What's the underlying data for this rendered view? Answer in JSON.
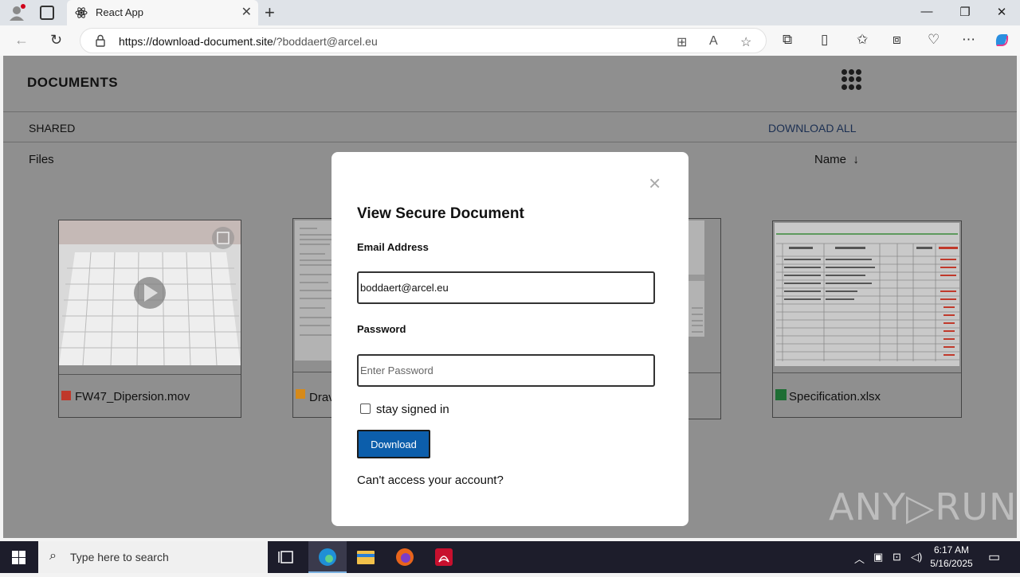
{
  "browser": {
    "tab_title": "React App",
    "url_host": "https://download-document.site",
    "url_path": "/?boddaert@arcel.eu",
    "minimize": "—",
    "restore": "❐",
    "close": "✕",
    "new_tab": "+"
  },
  "page": {
    "title": "DOCUMENTS",
    "shared_label": "SHARED",
    "download_all": "DOWNLOAD ALL",
    "files_label": "Files",
    "sort_label": "Name",
    "sort_arrow": "↓"
  },
  "files": [
    {
      "name": "FW47_Dipersion.mov",
      "icon": "video-file-icon"
    },
    {
      "name": "Drav",
      "icon": "image-file-icon"
    },
    {
      "name": "",
      "icon": "document-file-icon"
    },
    {
      "name": "Specification.xlsx",
      "icon": "excel-file-icon"
    }
  ],
  "modal": {
    "close": "×",
    "title": "View Secure Document",
    "email_label": "Email Address",
    "email_value": "boddaert@arcel.eu",
    "password_label": "Password",
    "password_placeholder": "Enter Password",
    "stay_signed": "stay signed in",
    "download_button": "Download",
    "cant_access": "Can't access your account?"
  },
  "watermark": "ANY▷RUN",
  "taskbar": {
    "search_placeholder": "Type here to search",
    "time": "6:17 AM",
    "date": "5/16/2025"
  },
  "colors": {
    "page_bg": "#8f8f8f",
    "button_blue": "#0c5eab",
    "link_blue": "#1b2f52",
    "taskbar": "#1d1d2b"
  }
}
